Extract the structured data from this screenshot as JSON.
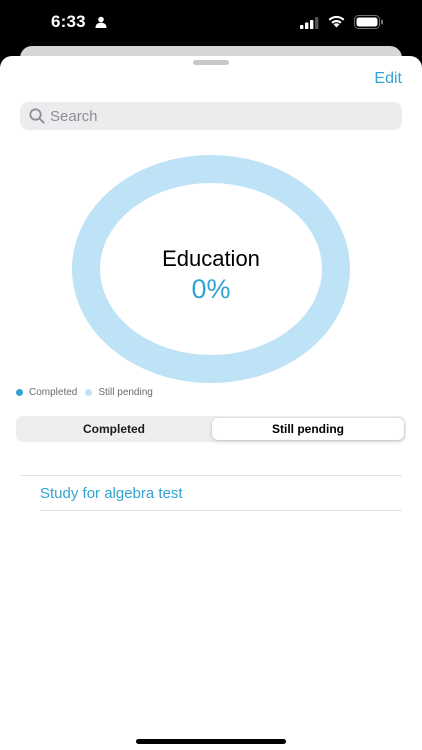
{
  "status_bar": {
    "time": "6:33",
    "person_icon": "person-icon",
    "signal_icon": "signal-icon",
    "wifi_icon": "wifi-icon",
    "battery_icon": "battery-icon"
  },
  "toolbar": {
    "edit_label": "Edit"
  },
  "search": {
    "placeholder": "Search",
    "icon": "search-icon"
  },
  "chart_data": {
    "type": "pie",
    "title": "Education",
    "center_value": "0%",
    "series": [
      {
        "name": "Completed",
        "value": 0,
        "color": "#33a3d2"
      },
      {
        "name": "Still pending",
        "value": 1,
        "color": "#bfe3f6"
      }
    ]
  },
  "segmented": {
    "options": [
      "Completed",
      "Still pending"
    ],
    "selected": "Still pending"
  },
  "list": {
    "items": [
      {
        "label": "Study for algebra test"
      }
    ]
  },
  "colors": {
    "accent": "#33a3d2",
    "ring_pending": "#bfe3f6",
    "background": "#ffffff"
  }
}
